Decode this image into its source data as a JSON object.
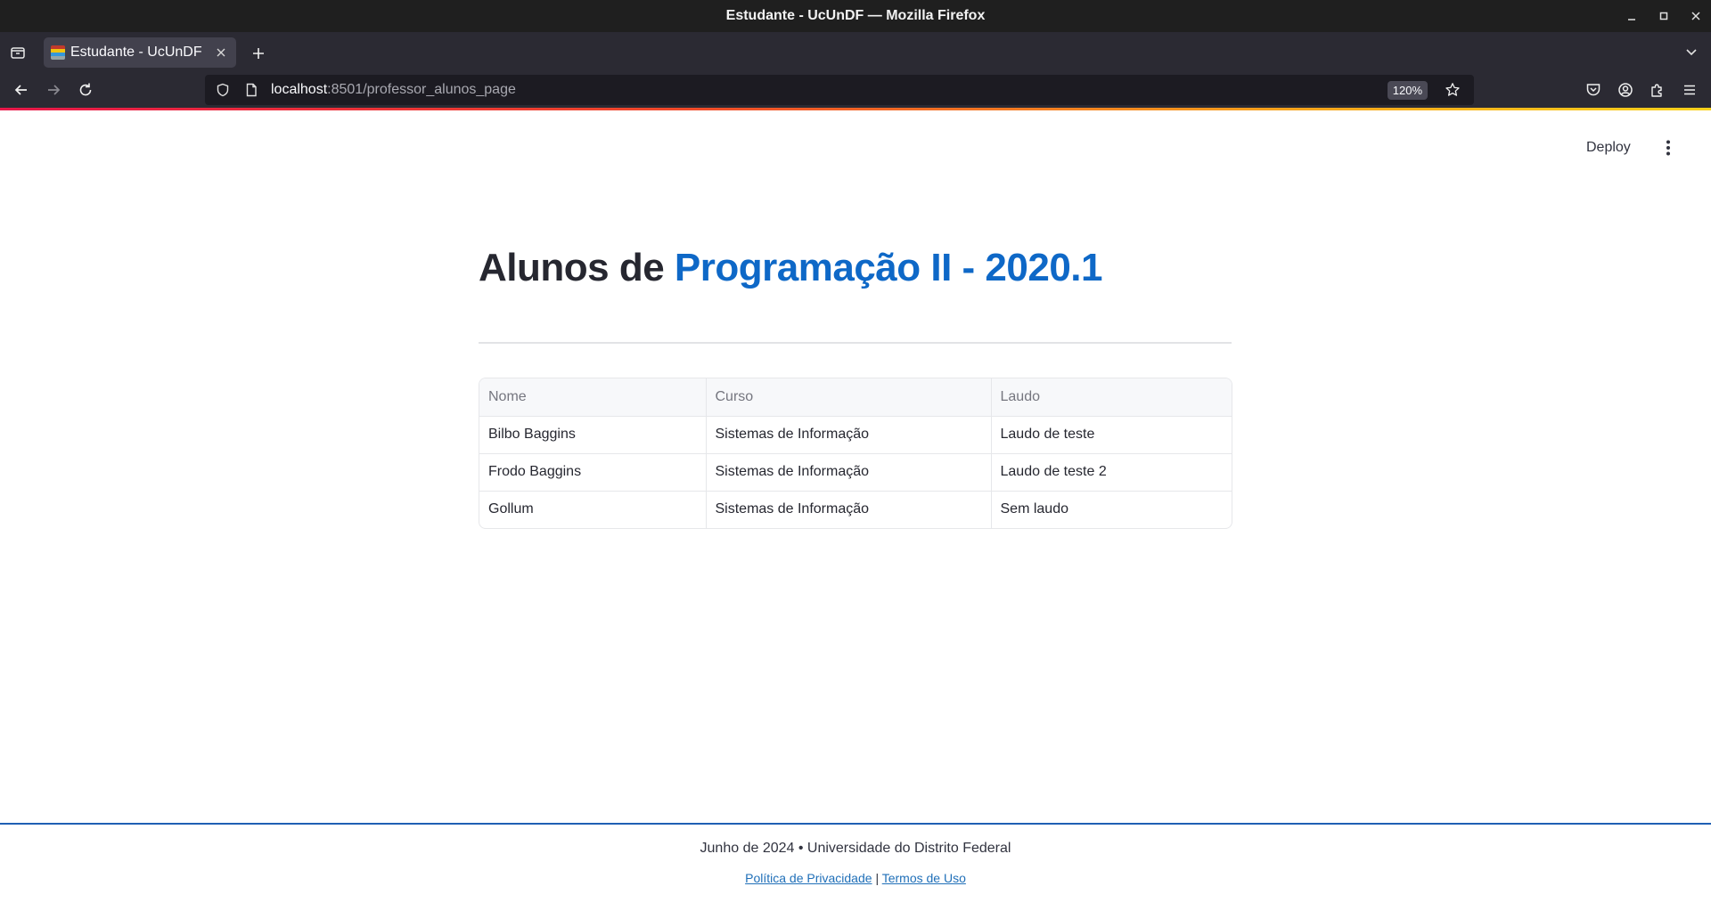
{
  "window": {
    "title": "Estudante - UcUnDF — Mozilla Firefox"
  },
  "tabs": [
    {
      "label": "Estudante - UcUnDF",
      "active": true
    }
  ],
  "navbar": {
    "url_host": "localhost",
    "url_rest": ":8501/professor_alunos_page",
    "zoom": "120%"
  },
  "app": {
    "deploy_label": "Deploy",
    "title_prefix": "Alunos de ",
    "title_accent": "Programação II - 2020.1",
    "accent_color": "#0e68c7"
  },
  "table": {
    "headers": [
      "Nome",
      "Curso",
      "Laudo"
    ],
    "rows": [
      [
        "Bilbo Baggins",
        "Sistemas de Informação",
        "Laudo de teste"
      ],
      [
        "Frodo Baggins",
        "Sistemas de Informação",
        "Laudo de teste 2"
      ],
      [
        "Gollum",
        "Sistemas de Informação",
        "Sem laudo"
      ]
    ]
  },
  "footer": {
    "text": "Junho de 2024 • Universidade do Distrito Federal",
    "privacy_link": "Política de Privacidade",
    "separator": "|",
    "terms_link": "Termos de Uso"
  },
  "icons": {
    "tab_list": "tab-list-icon",
    "back": "back-arrow-icon",
    "forward": "forward-arrow-icon",
    "reload": "reload-icon",
    "shield": "shield-icon",
    "page": "page-icon",
    "star": "star-icon",
    "pocket": "pocket-icon",
    "account": "account-icon",
    "extensions": "extensions-icon",
    "menu": "hamburger-menu-icon",
    "kebab": "kebab-menu-icon"
  }
}
